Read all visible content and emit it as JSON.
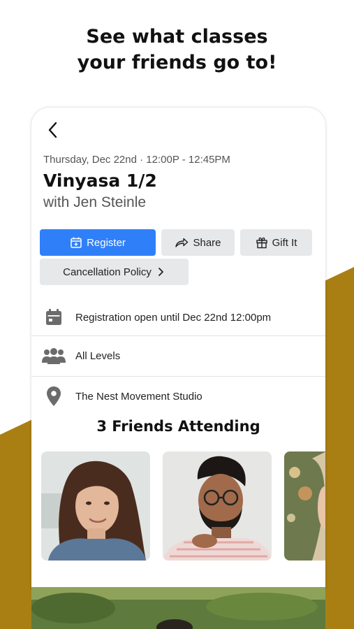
{
  "header": {
    "line1": "See what classes",
    "line2": "your friends go to!"
  },
  "class_detail": {
    "datetime": "Thursday, Dec 22nd · 12:00P - 12:45PM",
    "title": "Vinyasa 1/2",
    "instructor": "with Jen Steinle"
  },
  "actions": {
    "register": "Register",
    "share": "Share",
    "gift": "Gift It",
    "cancellation": "Cancellation Policy"
  },
  "info": {
    "registration": "Registration open until Dec 22nd 12:00pm",
    "level": "All Levels",
    "location": "The Nest Movement Studio"
  },
  "friends": {
    "title": "3 Friends Attending"
  },
  "colors": {
    "accent": "#2f80f8",
    "background_band": "#a97f14"
  },
  "icons": {
    "back": "chevron-left-icon",
    "register": "calendar-plus-icon",
    "share": "share-arrow-icon",
    "gift": "gift-icon",
    "cancellation": "chevron-right-icon",
    "registration": "calendar-icon",
    "level": "people-group-icon",
    "location": "map-pin-icon"
  }
}
